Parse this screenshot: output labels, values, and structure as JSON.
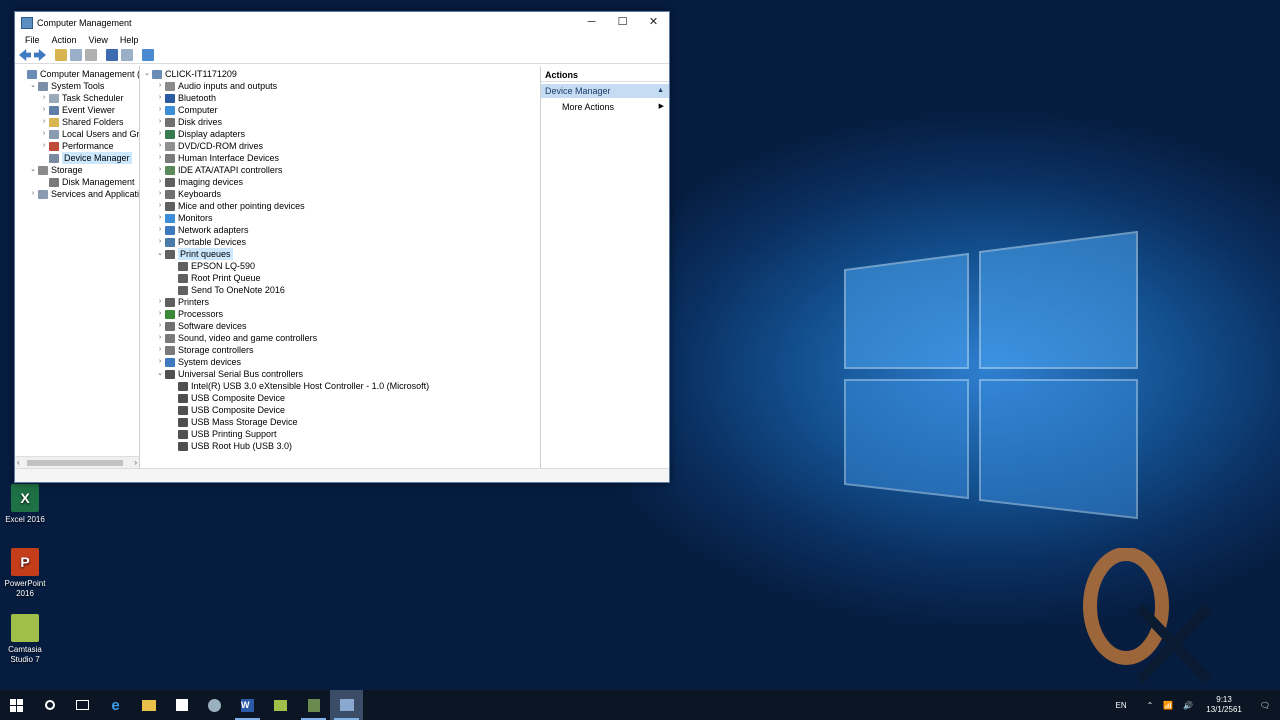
{
  "desktop": {
    "icons": [
      {
        "label": "Excel 2016",
        "color": "#1e7145",
        "glyph": "X"
      },
      {
        "label": "PowerPoint 2016",
        "color": "#c43e1c",
        "glyph": "P"
      },
      {
        "label": "Camtasia Studio 7",
        "color": "#9fbf4a",
        "glyph": ""
      }
    ]
  },
  "window": {
    "title": "Computer Management",
    "controls": {
      "minimize": "─",
      "maximize": "☐",
      "close": "✕"
    }
  },
  "menu": [
    "File",
    "Action",
    "View",
    "Help"
  ],
  "left_tree": [
    {
      "label": "Computer Management (Local",
      "level": 0,
      "twisty": "",
      "icon": "#6a8db5"
    },
    {
      "label": "System Tools",
      "level": 1,
      "twisty": "⌄",
      "icon": "#7c8ea8"
    },
    {
      "label": "Task Scheduler",
      "level": 2,
      "twisty": "›",
      "icon": "#9aa8b8"
    },
    {
      "label": "Event Viewer",
      "level": 2,
      "twisty": "›",
      "icon": "#5f7fa8"
    },
    {
      "label": "Shared Folders",
      "level": 2,
      "twisty": "›",
      "icon": "#d8b550"
    },
    {
      "label": "Local Users and Groups",
      "level": 2,
      "twisty": "›",
      "icon": "#8a9ab0"
    },
    {
      "label": "Performance",
      "level": 2,
      "twisty": "›",
      "icon": "#c04a3a"
    },
    {
      "label": "Device Manager",
      "level": 2,
      "twisty": "",
      "icon": "#7a8aa0",
      "selected": true
    },
    {
      "label": "Storage",
      "level": 1,
      "twisty": "⌄",
      "icon": "#8a8a8a"
    },
    {
      "label": "Disk Management",
      "level": 2,
      "twisty": "",
      "icon": "#7a7a7a"
    },
    {
      "label": "Services and Applications",
      "level": 1,
      "twisty": "›",
      "icon": "#8a9ab0"
    }
  ],
  "device_tree": [
    {
      "label": "CLICK-IT1171209",
      "level": 0,
      "twisty": "⌄",
      "icon": "#6a8db5"
    },
    {
      "label": "Audio inputs and outputs",
      "level": 1,
      "twisty": "›",
      "icon": "#8a8a8a"
    },
    {
      "label": "Bluetooth",
      "level": 1,
      "twisty": "›",
      "icon": "#2a5aa0"
    },
    {
      "label": "Computer",
      "level": 1,
      "twisty": "›",
      "icon": "#3d8ed8"
    },
    {
      "label": "Disk drives",
      "level": 1,
      "twisty": "›",
      "icon": "#707070"
    },
    {
      "label": "Display adapters",
      "level": 1,
      "twisty": "›",
      "icon": "#3a7a50"
    },
    {
      "label": "DVD/CD-ROM drives",
      "level": 1,
      "twisty": "›",
      "icon": "#909090"
    },
    {
      "label": "Human Interface Devices",
      "level": 1,
      "twisty": "›",
      "icon": "#7a7a7a"
    },
    {
      "label": "IDE ATA/ATAPI controllers",
      "level": 1,
      "twisty": "›",
      "icon": "#5a8a5a"
    },
    {
      "label": "Imaging devices",
      "level": 1,
      "twisty": "›",
      "icon": "#606060"
    },
    {
      "label": "Keyboards",
      "level": 1,
      "twisty": "›",
      "icon": "#707070"
    },
    {
      "label": "Mice and other pointing devices",
      "level": 1,
      "twisty": "›",
      "icon": "#606060"
    },
    {
      "label": "Monitors",
      "level": 1,
      "twisty": "›",
      "icon": "#3d8ed8"
    },
    {
      "label": "Network adapters",
      "level": 1,
      "twisty": "›",
      "icon": "#3d7ac0"
    },
    {
      "label": "Portable Devices",
      "level": 1,
      "twisty": "›",
      "icon": "#4a7aa8"
    },
    {
      "label": "Print queues",
      "level": 1,
      "twisty": "⌄",
      "icon": "#606060",
      "selected": true
    },
    {
      "label": "EPSON LQ-590",
      "level": 2,
      "twisty": "",
      "icon": "#606060"
    },
    {
      "label": "Root Print Queue",
      "level": 2,
      "twisty": "",
      "icon": "#606060"
    },
    {
      "label": "Send To OneNote 2016",
      "level": 2,
      "twisty": "",
      "icon": "#606060"
    },
    {
      "label": "Printers",
      "level": 1,
      "twisty": "›",
      "icon": "#606060"
    },
    {
      "label": "Processors",
      "level": 1,
      "twisty": "›",
      "icon": "#3a8a3a"
    },
    {
      "label": "Software devices",
      "level": 1,
      "twisty": "›",
      "icon": "#707070"
    },
    {
      "label": "Sound, video and game controllers",
      "level": 1,
      "twisty": "›",
      "icon": "#7a7a7a"
    },
    {
      "label": "Storage controllers",
      "level": 1,
      "twisty": "›",
      "icon": "#7a7a7a"
    },
    {
      "label": "System devices",
      "level": 1,
      "twisty": "›",
      "icon": "#3d7ac0"
    },
    {
      "label": "Universal Serial Bus controllers",
      "level": 1,
      "twisty": "⌄",
      "icon": "#505050"
    },
    {
      "label": "Intel(R) USB 3.0 eXtensible Host Controller - 1.0 (Microsoft)",
      "level": 2,
      "twisty": "",
      "icon": "#505050"
    },
    {
      "label": "USB Composite Device",
      "level": 2,
      "twisty": "",
      "icon": "#505050"
    },
    {
      "label": "USB Composite Device",
      "level": 2,
      "twisty": "",
      "icon": "#505050"
    },
    {
      "label": "USB Mass Storage Device",
      "level": 2,
      "twisty": "",
      "icon": "#505050"
    },
    {
      "label": "USB Printing Support",
      "level": 2,
      "twisty": "",
      "icon": "#505050"
    },
    {
      "label": "USB Root Hub (USB 3.0)",
      "level": 2,
      "twisty": "",
      "icon": "#505050"
    }
  ],
  "actions": {
    "header": "Actions",
    "section": "Device Manager",
    "item": "More Actions"
  },
  "taskbar": {
    "language": "EN",
    "time": "9:13",
    "date": "13/1/2561"
  },
  "colors": {
    "selection": "#cce8ff",
    "actions_section": "#c6dcf2",
    "taskbar": "#0b1523",
    "accent": "#7fb0e6"
  }
}
